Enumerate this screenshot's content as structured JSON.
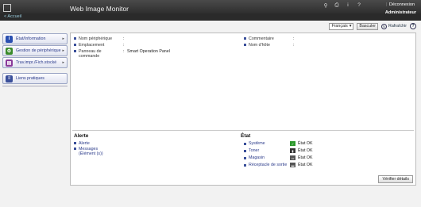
{
  "header": {
    "app_title": "Web Image Monitor",
    "logout_label": "Déconnexion",
    "user_label": "Administrateur",
    "breadcrumb": "< Accueil"
  },
  "sidebar": {
    "items": [
      {
        "label": "État/Information",
        "icon": "info-icon",
        "color": "#2a4fb0"
      },
      {
        "label": "Gestion de périphérique",
        "icon": "device-gear-icon",
        "color": "#3a8a2a"
      },
      {
        "label": "Trav.impr./Fich.stocké",
        "icon": "print-jobs-icon",
        "color": "#8a3a9a"
      },
      {
        "label": "Liens pratiques",
        "icon": "links-icon",
        "color": "#3a4f9a"
      }
    ]
  },
  "toolbar": {
    "language": "Français",
    "switch_label": "Basculer",
    "refresh_label": "Rafraîchir",
    "help_label": "?"
  },
  "info": {
    "left": [
      {
        "key": "Nom périphérique",
        "value": ""
      },
      {
        "key": "Emplacement",
        "value": ""
      },
      {
        "key": "Panneau de commande",
        "value": "Smart Operation Panel"
      }
    ],
    "right": [
      {
        "key": "Commentaire",
        "value": ""
      },
      {
        "key": "Nom d'hôte",
        "value": ""
      }
    ]
  },
  "alerts": {
    "title": "Alerte",
    "items": [
      "Alerte",
      "Messages (Élément (s))"
    ]
  },
  "status": {
    "title": "État",
    "items": [
      {
        "key": "Système",
        "value": "État OK",
        "icon": "system-ok-icon",
        "color": "#2e9a2e"
      },
      {
        "key": "Toner",
        "value": "État OK",
        "icon": "toner-icon",
        "color": "#333333"
      },
      {
        "key": "Magasin",
        "value": "État OK",
        "icon": "tray-icon",
        "color": "#555555"
      },
      {
        "key": "Réceptacle de sortie",
        "value": "État OK",
        "icon": "output-tray-icon",
        "color": "#555555"
      }
    ]
  },
  "details_label": "Vérifier détails"
}
